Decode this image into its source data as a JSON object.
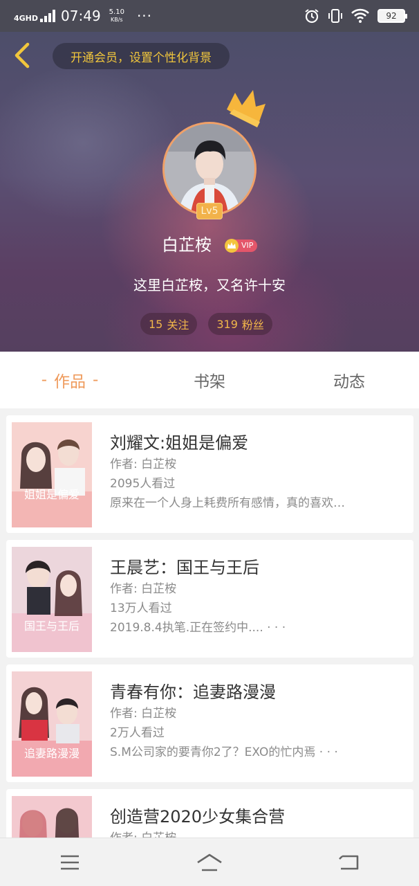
{
  "status_bar": {
    "network": "4GHD",
    "time": "07:49",
    "speed_value": "5.10",
    "speed_unit": "KB/s",
    "more": "···",
    "battery": "92"
  },
  "header": {
    "banner_text": "开通会员，设置个性化背景"
  },
  "profile": {
    "level": "Lv5",
    "name": "白芷桉",
    "vip_label": "VIP",
    "bio": "这里白芷桉，又名许十安",
    "following_count": "15",
    "following_label": "关注",
    "followers_count": "319",
    "followers_label": "粉丝"
  },
  "tabs": [
    {
      "label": "作品",
      "active": true
    },
    {
      "label": "书架",
      "active": false
    },
    {
      "label": "动态",
      "active": false
    }
  ],
  "tab_dash": "-",
  "works": [
    {
      "title": "刘耀文:姐姐是偏爱",
      "author": "作者: 白芷桉",
      "views": "2095人看过",
      "desc": "原来在一个人身上耗费所有感情，真的喜欢…",
      "cover_text": "姐姐是偏爱",
      "color": "#f6c8c8"
    },
    {
      "title": "王晨艺：国王与王后",
      "author": "作者: 白芷桉",
      "views": "13万人看过",
      "desc": "2019.8.4执笔.正在签约中.... · · ·",
      "cover_text": "国王与王后",
      "color": "#e9cfd6"
    },
    {
      "title": "青春有你：追妻路漫漫",
      "author": "作者: 白芷桉",
      "views": "2万人看过",
      "desc": "S.M公司家的要青你2了？EXO的忙内焉 · · ·",
      "cover_text": "追妻路漫漫",
      "color": "#f4b9bf"
    },
    {
      "title": "创造营2020少女集合营",
      "author": "作者: 白芷桉",
      "views": "",
      "desc": "",
      "cover_text": "",
      "color": "#f3c9cf"
    }
  ],
  "colors": {
    "accent": "#ef9a5b",
    "gold": "#f1c63c",
    "text_muted": "#8a8a8a"
  },
  "icons": {
    "back": "chevron-left-icon",
    "crown": "crown-icon",
    "menu": "menu-icon",
    "home": "home-icon",
    "return": "return-icon"
  }
}
